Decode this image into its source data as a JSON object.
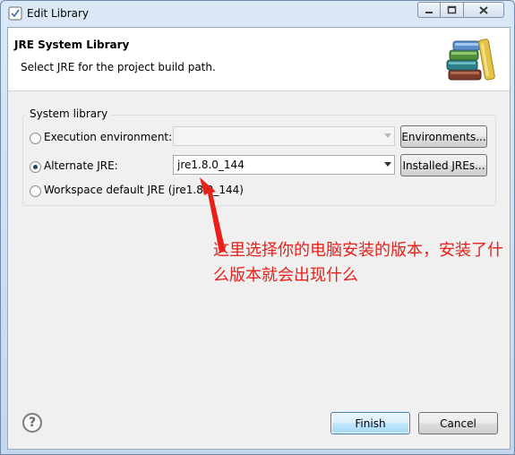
{
  "window": {
    "title": "Edit Library",
    "controls": [
      "minimize",
      "maximize",
      "close"
    ]
  },
  "header": {
    "title": "JRE System Library",
    "description": "Select JRE for the project build path."
  },
  "group": {
    "label": "System library",
    "options": [
      {
        "label": "Execution environment:",
        "selected": false,
        "combo_value": "",
        "combo_enabled": false,
        "button": "Environments..."
      },
      {
        "label": "Alternate JRE:",
        "selected": true,
        "combo_value": "jre1.8.0_144",
        "combo_enabled": true,
        "button": "Installed JREs..."
      },
      {
        "label": "Workspace default JRE (jre1.8.0_144)",
        "selected": false
      }
    ]
  },
  "annotation": {
    "text": "这里选择你的电脑安装的版本，安装了什么版本就会出现什么",
    "color": "#e8201a"
  },
  "footer": {
    "help_icon": "?",
    "finish_label": "Finish",
    "cancel_label": "Cancel"
  }
}
